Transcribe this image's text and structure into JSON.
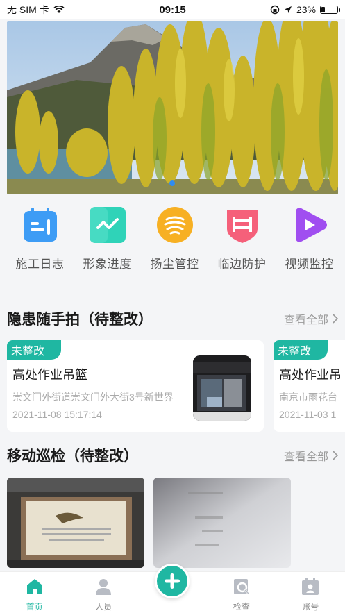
{
  "status": {
    "carrier": "无 SIM 卡",
    "time": "09:15",
    "battery": "23%"
  },
  "banner": {
    "active_dot": 1
  },
  "menu": [
    {
      "label": "施工日志",
      "icon": "calendar-icon",
      "color": "#3d9cf5"
    },
    {
      "label": "形象进度",
      "icon": "chart-icon",
      "color": "#2fd3b8"
    },
    {
      "label": "扬尘管控",
      "icon": "dust-icon",
      "color": "#f7b023"
    },
    {
      "label": "临边防护",
      "icon": "barrier-icon",
      "color": "#f5607a"
    },
    {
      "label": "视频监控",
      "icon": "video-icon",
      "color": "#a04ef0"
    }
  ],
  "hazards": {
    "title": "隐患随手拍（待整改）",
    "more": "查看全部",
    "cards": [
      {
        "badge": "未整改",
        "name": "高处作业吊篮",
        "address": "崇文门外街道崇文门外大街3号新世界",
        "time": "2021-11-08 15:17:14"
      },
      {
        "badge": "未整改",
        "name": "高处作业吊",
        "address": "南京市雨花台",
        "time": "2021-11-03 1"
      }
    ]
  },
  "patrol": {
    "title": "移动巡检（待整改）",
    "more": "查看全部"
  },
  "tabbar": [
    {
      "label": "首页",
      "icon": "home-icon",
      "active": true
    },
    {
      "label": "人员",
      "icon": "person-icon",
      "active": false
    },
    {
      "label": "",
      "icon": "plus-icon",
      "active": false
    },
    {
      "label": "检查",
      "icon": "inspect-icon",
      "active": false
    },
    {
      "label": "账号",
      "icon": "account-icon",
      "active": false
    }
  ],
  "colors": {
    "accent": "#1fb7a2"
  }
}
